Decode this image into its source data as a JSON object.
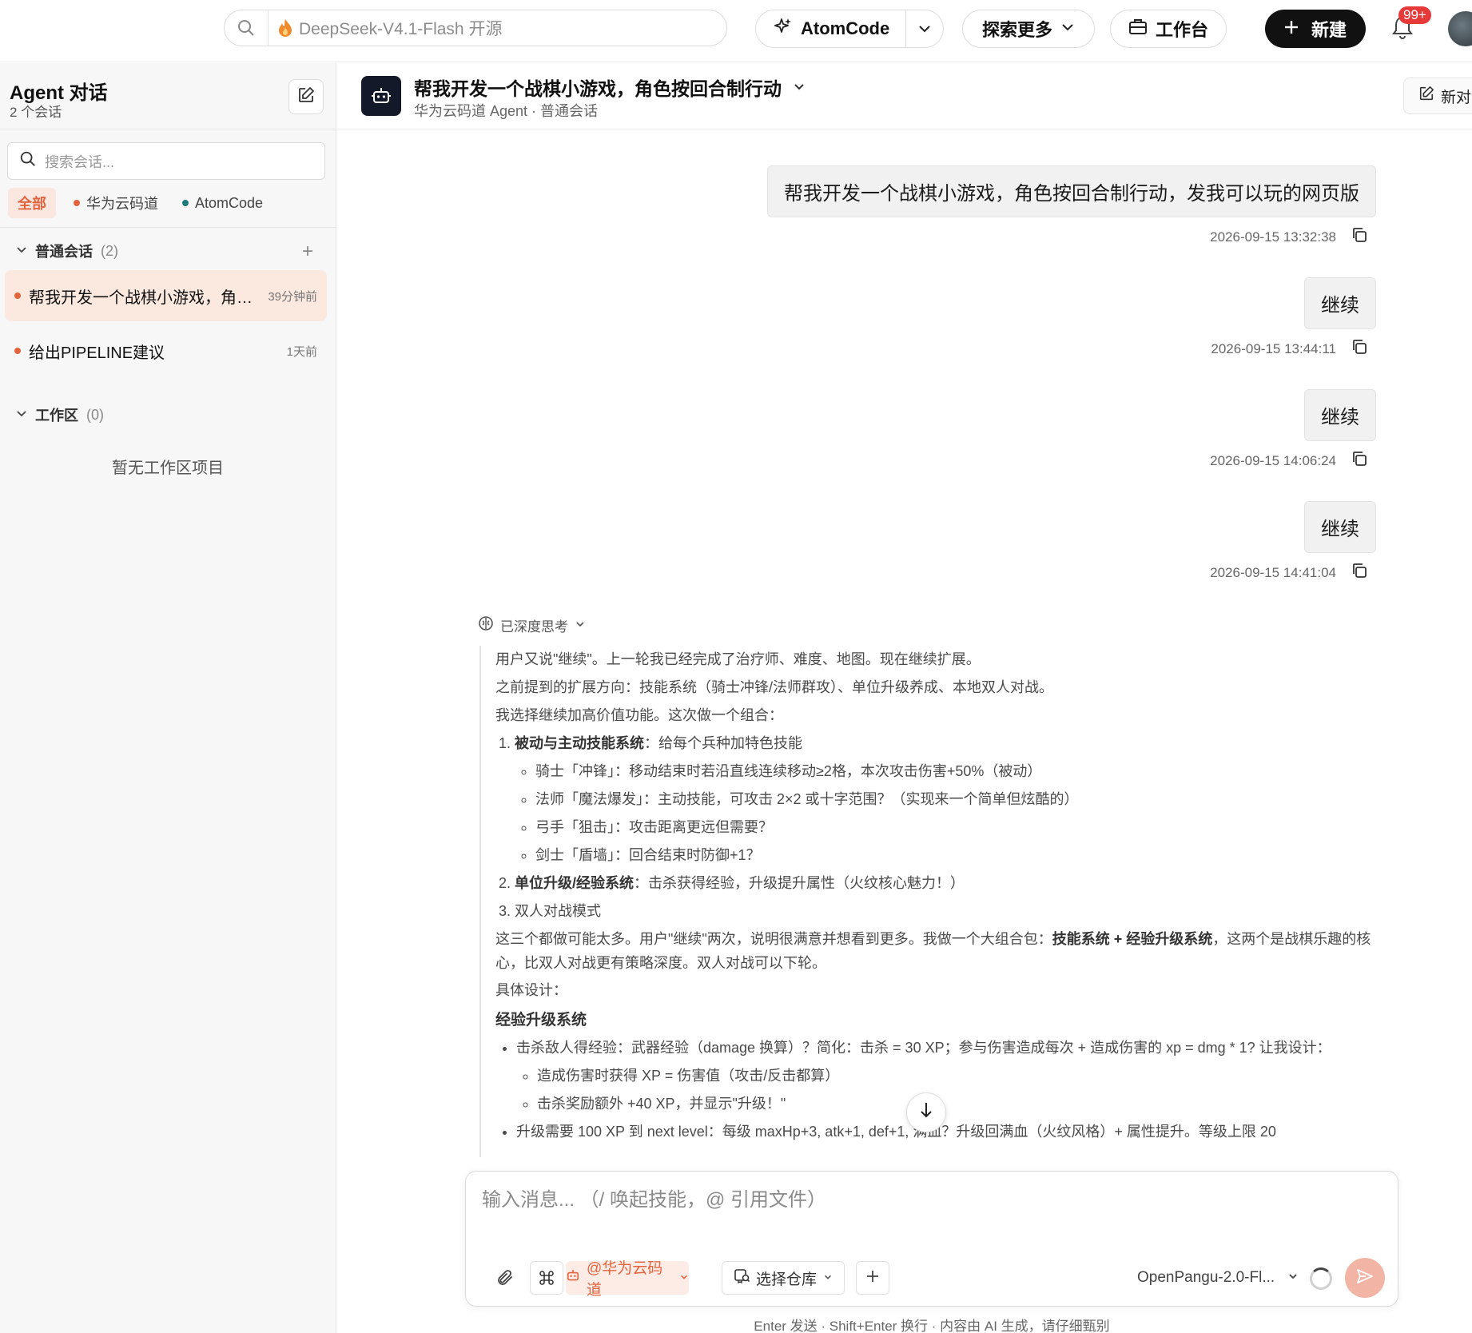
{
  "topbar": {
    "search_placeholder": "DeepSeek-V4.1-Flash 开源",
    "atomcode_label": "AtomCode",
    "explore_label": "探索更多",
    "workbench_label": "工作台",
    "new_label": "新建",
    "notification_badge": "99+"
  },
  "sidebar": {
    "title": "Agent 对话",
    "subtitle": "2 个会话",
    "search_placeholder": "搜索会话...",
    "filters": [
      {
        "label": "全部"
      },
      {
        "label": "华为云码道",
        "color": "#e2643d"
      },
      {
        "label": "AtomCode",
        "color": "#1f7a7a"
      }
    ],
    "groups": {
      "general": {
        "label": "普通会话",
        "count": "(2)"
      },
      "workspace": {
        "label": "工作区",
        "count": "(0)",
        "empty_text": "暂无工作区项目"
      }
    },
    "conversations": [
      {
        "title": "帮我开发一个战棋小游戏，角色按回合制行动，发我可以玩的网页版",
        "time": "39分钟前"
      },
      {
        "title": "给出PIPELINE建议",
        "time": "1天前"
      }
    ]
  },
  "chat": {
    "title": "帮我开发一个战棋小游戏，角色按回合制行动",
    "subtitle": "华为云码道 Agent · 普通会话",
    "new_chat_label": "新对话",
    "messages": [
      {
        "text": "帮我开发一个战棋小游戏，角色按回合制行动，发我可以玩的网页版",
        "time": "2026-09-15 13:32:38"
      },
      {
        "text": "继续",
        "time": "2026-09-15 13:44:11"
      },
      {
        "text": "继续",
        "time": "2026-09-15 14:06:24"
      },
      {
        "text": "继续",
        "time": "2026-09-15 14:41:04"
      }
    ],
    "thinking": {
      "toggle_label": "已深度思考",
      "p1": "用户又说\"继续\"。上一轮我已经完成了治疗师、难度、地图。现在继续扩展。",
      "p2": "之前提到的扩展方向：技能系统（骑士冲锋/法师群攻）、单位升级养成、本地双人对战。",
      "p3": "我选择继续加高价值功能。这次做一个组合：",
      "item1_bold": "被动与主动技能系统",
      "item1_rest": "：给每个兵种加特色技能",
      "skills": [
        "骑士「冲锋」：移动结束时若沿直线连续移动≥2格，本次攻击伤害+50%（被动）",
        "法师「魔法爆发」：主动技能，可攻击 2×2 或十字范围？（实现来一个简单但炫酷的）",
        "弓手「狙击」：攻击距离更远但需要？",
        "剑士「盾墙」：回合结束时防御+1？"
      ],
      "item2_bold": "单位升级/经验系统",
      "item2_rest": "：击杀获得经验，升级提升属性（火纹核心魅力！）",
      "item3": "双人对战模式",
      "p4_a": "这三个都做可能太多。用户\"继续\"两次，说明很满意并想看到更多。我做一个大组合包：",
      "p4_b1": "技能系统",
      "p4_plus": " + ",
      "p4_b2": "经验升级系统",
      "p4_c": "，这两个是战棋乐趣的核心，比双人对战更有策略深度。双人对战可以下轮。",
      "p5": "具体设计：",
      "heading": "经验升级系统",
      "bullet1": "击杀敌人得经验：武器经验（damage 换算）？简化：击杀 = 30 XP；参与伤害造成每次 + 造成伤害的 xp = dmg * 1? 让我设计：",
      "sub1": "造成伤害时获得 XP = 伤害值（攻击/反击都算）",
      "sub2": "击杀奖励额外 +40 XP，并显示\"升级！\"",
      "bullet2": "升级需要 100 XP 到 next level：每级 maxHp+3, atk+1, def+1, 满血？升级回满血（火纹风格）+ 属性提升。等级上限 20"
    }
  },
  "composer": {
    "placeholder": "输入消息... （/ 唤起技能，@ 引用文件）",
    "agent_label": "@华为云码道",
    "repo_label": "选择仓库",
    "model_label": "OpenPangu-2.0-Fl...",
    "footer": "Enter 发送 · Shift+Enter 换行 · 内容由 AI 生成，请仔细甄别"
  },
  "colors": {
    "accent": "#e2643d",
    "primary_dark": "#111111",
    "send_disabled": "#f2b4a4"
  }
}
